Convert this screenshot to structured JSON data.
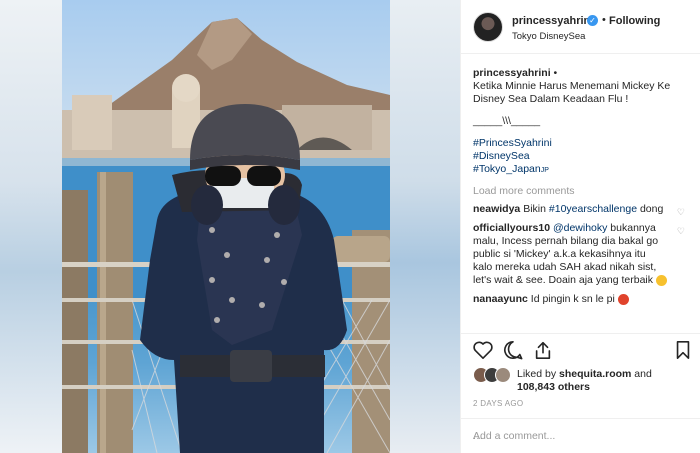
{
  "post": {
    "username": "princessyahrini",
    "follow_label": "Following",
    "separator": "•",
    "location": "Tokyo DisneySea"
  },
  "caption": {
    "username": "princessyahrini",
    "suffix": "•",
    "text": "Ketika Minnie Harus Menemani Mickey Ke Disney Sea Dalam Keadaan Flu !",
    "divider": "_____\\\\\\_____",
    "hashtags": [
      "#PrincesSyahrini",
      "#DisneySea",
      "#Tokyo_Japan"
    ],
    "jp_suffix": "JP"
  },
  "load_more": "Load more comments",
  "comments": [
    {
      "user": "neawidya",
      "pre": "Bikin ",
      "mention": "#10yearschallenge",
      "post": " dong"
    },
    {
      "user": "officiallyours10",
      "pre": "",
      "mention": "@dewihoky",
      "post": " bukannya malu, Incess pernah bilang dia bakal go public si 'Mickey' a.k.a kekasihnya itu kalo mereka udah SAH akad nikah sist, let's wait & see. Doain aja yang terbaik"
    },
    {
      "user": "nanaayunc",
      "pre": "",
      "mention": "",
      "post": "Id pingin k sn le pi"
    }
  ],
  "likes": {
    "prefix": "Liked by ",
    "user": "shequita.room",
    "mid": " and",
    "count": "108,843 others"
  },
  "timestamp": "2 DAYS AGO",
  "add_comment_placeholder": "Add a comment...",
  "more_icon": "...",
  "icons": {
    "like": "heart-icon",
    "comment": "comment-icon",
    "share": "share-icon",
    "save": "bookmark-icon",
    "verified": "verified-badge-icon"
  },
  "colors": {
    "link": "#003569",
    "verified": "#3897f0",
    "muted": "#999999"
  }
}
